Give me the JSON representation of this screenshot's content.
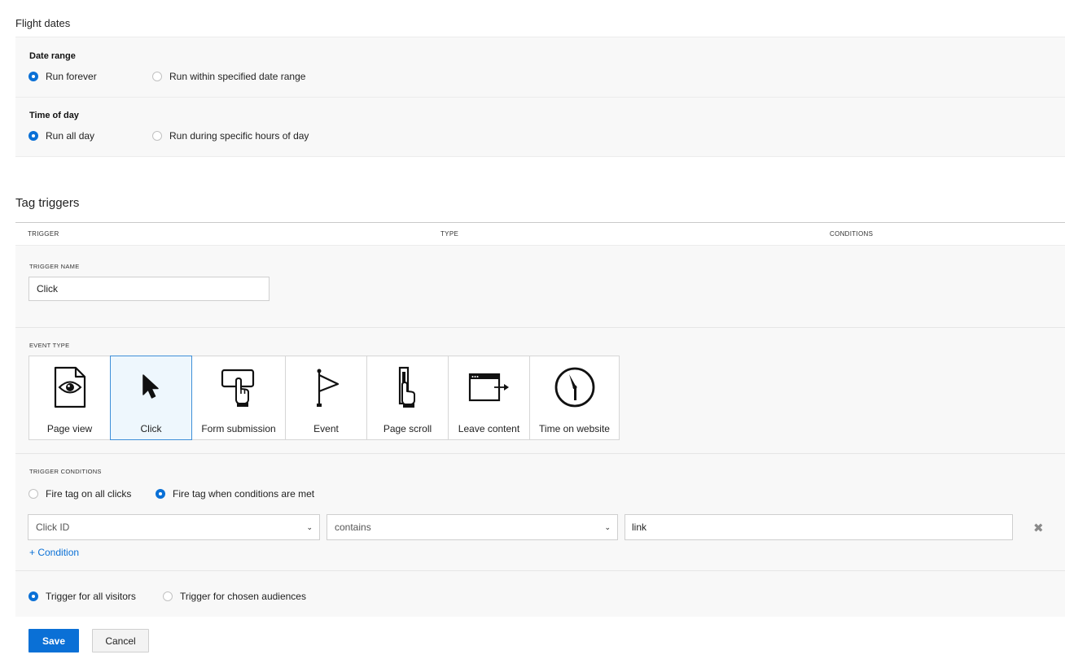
{
  "flight_dates": {
    "title": "Flight dates",
    "date_range": {
      "label": "Date range",
      "options": [
        "Run forever",
        "Run within specified date range"
      ],
      "selected": "Run forever"
    },
    "time_of_day": {
      "label": "Time of day",
      "options": [
        "Run all day",
        "Run during specific hours of day"
      ],
      "selected": "Run all day"
    }
  },
  "tag_triggers": {
    "title": "Tag triggers",
    "columns": [
      "TRIGGER",
      "TYPE",
      "CONDITIONS"
    ],
    "trigger_name": {
      "label": "TRIGGER NAME",
      "value": "Click"
    },
    "event_type": {
      "label": "EVENT TYPE",
      "selected": "Click",
      "options": [
        {
          "label": "Page view",
          "icon": "page-view-icon"
        },
        {
          "label": "Click",
          "icon": "cursor-icon"
        },
        {
          "label": "Form submission",
          "icon": "form-submission-icon"
        },
        {
          "label": "Event",
          "icon": "flag-icon"
        },
        {
          "label": "Page scroll",
          "icon": "page-scroll-icon"
        },
        {
          "label": "Leave content",
          "icon": "leave-content-icon"
        },
        {
          "label": "Time on website",
          "icon": "clock-icon"
        }
      ]
    },
    "trigger_conditions": {
      "label": "TRIGGER CONDITIONS",
      "options": [
        "Fire tag on all clicks",
        "Fire tag when conditions are met"
      ],
      "selected": "Fire tag when conditions are met",
      "condition": {
        "field": "Click ID",
        "operator": "contains",
        "value": "link"
      },
      "add_condition_label": "+ Condition",
      "remove_icon": "close-icon"
    },
    "audience": {
      "options": [
        "Trigger for all visitors",
        "Trigger for chosen audiences"
      ],
      "selected": "Trigger for all visitors"
    }
  },
  "actions": {
    "save_label": "Save",
    "cancel_label": "Cancel"
  },
  "colors": {
    "accent": "#0a70d6",
    "selected_tile_bg": "#eef7fd",
    "panel_bg": "#f8f8f8"
  }
}
